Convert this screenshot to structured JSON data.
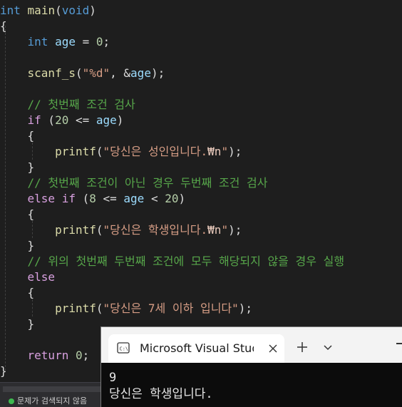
{
  "editor": {
    "lines": [
      {
        "id": "l1",
        "tokens": [
          [
            "kw",
            "int"
          ],
          [
            "pl",
            " "
          ],
          [
            "fn",
            "main"
          ],
          [
            "pl",
            "("
          ],
          [
            "kw",
            "void"
          ],
          [
            "pl",
            ")"
          ]
        ]
      },
      {
        "id": "l2",
        "tokens": [
          [
            "pl",
            "{"
          ]
        ]
      },
      {
        "id": "l3",
        "tokens": [
          [
            "pl",
            "    "
          ],
          [
            "kw",
            "int"
          ],
          [
            "pl",
            " "
          ],
          [
            "var",
            "age"
          ],
          [
            "pl",
            " = "
          ],
          [
            "num",
            "0"
          ],
          [
            "pl",
            ";"
          ]
        ]
      },
      {
        "id": "l4",
        "tokens": [
          [
            "pl",
            "    "
          ],
          [
            "fn",
            "scanf_s"
          ],
          [
            "pl",
            "("
          ],
          [
            "str",
            "\"%d\""
          ],
          [
            "pl",
            ", &"
          ],
          [
            "var",
            "age"
          ],
          [
            "pl",
            ");"
          ]
        ]
      },
      {
        "id": "l5",
        "tokens": [
          [
            "pl",
            "    "
          ],
          [
            "cmt",
            "// 첫번째 조건 검사"
          ]
        ]
      },
      {
        "id": "l6",
        "tokens": [
          [
            "pl",
            "    "
          ],
          [
            "ctl",
            "if"
          ],
          [
            "pl",
            " ("
          ],
          [
            "num",
            "20"
          ],
          [
            "pl",
            " <= "
          ],
          [
            "var",
            "age"
          ],
          [
            "pl",
            ")"
          ]
        ]
      },
      {
        "id": "l7",
        "tokens": [
          [
            "pl",
            "    {"
          ]
        ]
      },
      {
        "id": "l8",
        "tokens": [
          [
            "pl",
            "        "
          ],
          [
            "fn",
            "printf"
          ],
          [
            "pl",
            "("
          ],
          [
            "str",
            "\"당신은 성인입니다."
          ],
          [
            "esc",
            "₩n"
          ],
          [
            "str",
            "\""
          ],
          [
            "pl",
            ");"
          ]
        ]
      },
      {
        "id": "l9",
        "tokens": [
          [
            "pl",
            "    }"
          ]
        ]
      },
      {
        "id": "l10",
        "tokens": [
          [
            "pl",
            "    "
          ],
          [
            "cmt",
            "// 첫번째 조건이 아닌 경우 두번째 조건 검사"
          ]
        ]
      },
      {
        "id": "l11",
        "tokens": [
          [
            "pl",
            "    "
          ],
          [
            "ctl",
            "else if"
          ],
          [
            "pl",
            " ("
          ],
          [
            "num",
            "8"
          ],
          [
            "pl",
            " <= "
          ],
          [
            "var",
            "age"
          ],
          [
            "pl",
            " < "
          ],
          [
            "num",
            "20"
          ],
          [
            "pl",
            ")"
          ]
        ]
      },
      {
        "id": "l12",
        "tokens": [
          [
            "pl",
            "    {"
          ]
        ]
      },
      {
        "id": "l13",
        "tokens": [
          [
            "pl",
            "        "
          ],
          [
            "fn",
            "printf"
          ],
          [
            "pl",
            "("
          ],
          [
            "str",
            "\"당신은 학생입니다."
          ],
          [
            "esc",
            "₩n"
          ],
          [
            "str",
            "\""
          ],
          [
            "pl",
            ");"
          ]
        ]
      },
      {
        "id": "l14",
        "tokens": [
          [
            "pl",
            "    }"
          ]
        ]
      },
      {
        "id": "l15",
        "tokens": [
          [
            "pl",
            "    "
          ],
          [
            "cmt",
            "// 위의 첫번째 두번째 조건에 모두 해당되지 않을 경우 실행"
          ]
        ]
      },
      {
        "id": "l16",
        "tokens": [
          [
            "pl",
            "    "
          ],
          [
            "ctl",
            "else"
          ]
        ]
      },
      {
        "id": "l17",
        "tokens": [
          [
            "pl",
            "    {"
          ]
        ]
      },
      {
        "id": "l18",
        "tokens": [
          [
            "pl",
            "        "
          ],
          [
            "fn",
            "printf"
          ],
          [
            "pl",
            "("
          ],
          [
            "str",
            "\"당신은 7세 이하 입니다\""
          ],
          [
            "pl",
            ");"
          ]
        ]
      },
      {
        "id": "l19",
        "tokens": [
          [
            "pl",
            "    }"
          ]
        ]
      },
      {
        "id": "l20",
        "tokens": [
          [
            "pl",
            "    "
          ],
          [
            "ctl",
            "return"
          ],
          [
            "pl",
            " "
          ],
          [
            "num",
            "0"
          ],
          [
            "pl",
            ";"
          ]
        ]
      },
      {
        "id": "l21",
        "tokens": [
          [
            "pl",
            "}"
          ]
        ]
      }
    ]
  },
  "status": {
    "text": "문제가 검색되지 않음"
  },
  "terminal": {
    "tab_title": "Microsoft Visual Studio Debug Console",
    "output_lines": [
      "9",
      "당신은 학생입니다."
    ]
  }
}
